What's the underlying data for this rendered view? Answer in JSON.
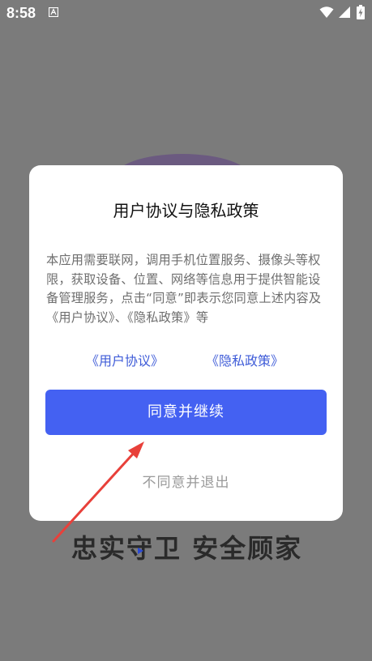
{
  "status_bar": {
    "time": "8:58",
    "notification_icon": "a-icon",
    "wifi_icon": "wifi-icon",
    "signal_icon": "signal-icon",
    "battery_icon": "battery-charging-icon"
  },
  "background": {
    "slogan": "忠实守卫 安全顾家"
  },
  "dialog": {
    "title": "用户协议与隐私政策",
    "body": "本应用需要联网，调用手机位置服务、摄像头等权限，获取设备、位置、网络等信息用于提供智能设备管理服务，点击“同意”即表示您同意上述内容及《用户协议》、《隐私政策》等",
    "link_user_agreement": "《用户协议》",
    "link_privacy_policy": "《隐私政策》",
    "agree_button": "同意并继续",
    "disagree_button": "不同意并退出"
  },
  "colors": {
    "primary": "#4461F2",
    "link": "#3F5CD8",
    "overlay": "#7B7B7B",
    "annotation_arrow": "#E8403A"
  }
}
